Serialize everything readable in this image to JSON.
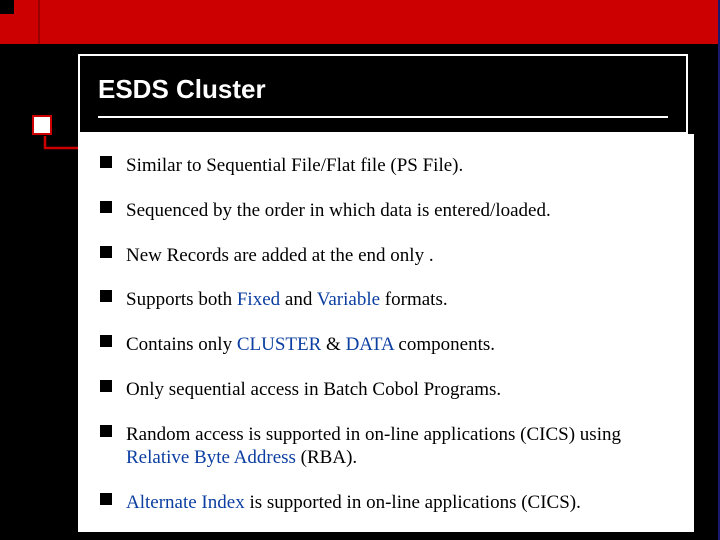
{
  "title": "ESDS Cluster",
  "bullets": [
    {
      "pre": "Similar to Sequential File/Flat file (PS File)."
    },
    {
      "pre": "Sequenced by the order in which data is entered/loaded."
    },
    {
      "pre": "New Records are added at the end only ."
    },
    {
      "pre": "Supports both ",
      "em1": "Fixed",
      "mid1": " and ",
      "em2": "Variable",
      "post": " formats."
    },
    {
      "pre": "Contains only ",
      "em1": "CLUSTER",
      "mid1": " & ",
      "em2": "DATA",
      "post": " components."
    },
    {
      "pre": "Only sequential access in Batch Cobol Programs."
    },
    {
      "pre": "Random access is supported in on-line applications (CICS) using ",
      "em1": "Relative Byte Address",
      "post": " (RBA)."
    },
    {
      "em1": "Alternate Index",
      "post": " is supported in on-line applications (CICS)."
    }
  ]
}
